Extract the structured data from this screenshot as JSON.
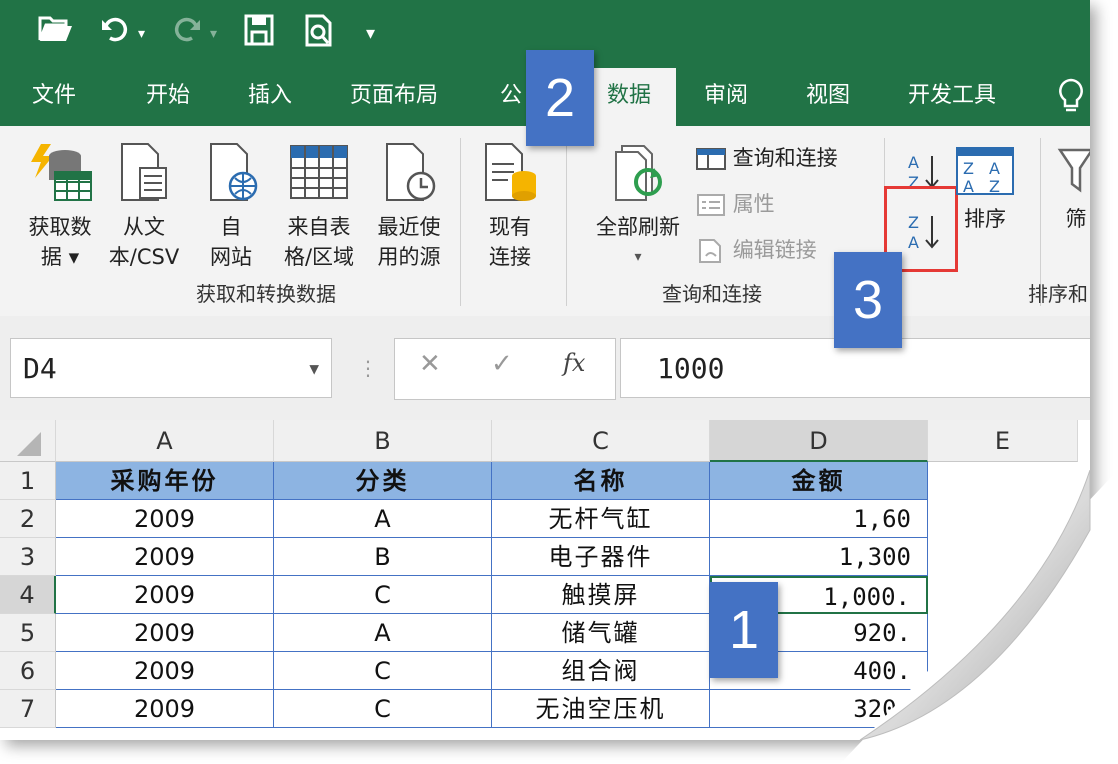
{
  "quick_access": {
    "open_icon": "folder-open-icon",
    "undo_icon": "undo-icon",
    "redo_icon": "redo-icon",
    "save_icon": "save-icon",
    "print_preview_icon": "print-preview-icon",
    "customize_icon": "customize-qat-icon"
  },
  "tabs": [
    {
      "label": "文件"
    },
    {
      "label": "开始"
    },
    {
      "label": "插入"
    },
    {
      "label": "页面布局"
    },
    {
      "label": "公"
    },
    {
      "label": "数据"
    },
    {
      "label": "审阅"
    },
    {
      "label": "视图"
    },
    {
      "label": "开发工具"
    }
  ],
  "ribbon": {
    "get_data": "获取数\n据 ▾",
    "from_text": "从文\n本/CSV",
    "from_web": "自\n网站",
    "from_table": "来自表\n格/区域",
    "recent_sources": "最近使\n用的源",
    "existing_connections": "现有\n连接",
    "group_get_transform": "获取和转换数据",
    "refresh_all": "全部刷新",
    "refresh_all_arrow": "▾",
    "queries_connections": "查询和连接",
    "properties": "属性",
    "edit_links": "编辑链接",
    "group_queries": "查询和连接",
    "sort": "排序",
    "filter": "筛",
    "group_sort": "排序和"
  },
  "formula_bar": {
    "name_box": "D4",
    "cancel": "✕",
    "enter": "✓",
    "fx": "fx",
    "value": "1000"
  },
  "sheet": {
    "columns": [
      "A",
      "B",
      "C",
      "D",
      "E"
    ],
    "rows": [
      "1",
      "2",
      "3",
      "4",
      "5",
      "6",
      "7"
    ],
    "header": [
      "采购年份",
      "分类",
      "名称",
      "金额"
    ],
    "data": [
      [
        "2009",
        "A",
        "无杆气缸",
        "1,60"
      ],
      [
        "2009",
        "B",
        "电子器件",
        "1,300"
      ],
      [
        "2009",
        "C",
        "触摸屏",
        "1,000."
      ],
      [
        "2009",
        "A",
        "储气罐",
        "920."
      ],
      [
        "2009",
        "C",
        "组合阀",
        "400."
      ],
      [
        "2009",
        "C",
        "无油空压机",
        "320."
      ]
    ]
  },
  "annotations": {
    "step1": "1",
    "step2": "2",
    "step3": "3",
    "highlight_color": "#e53935",
    "badge_color": "#4472c4"
  },
  "colors": {
    "excel_green": "#217346",
    "header_fill": "#8db4e2",
    "grid_border": "#4472c4"
  }
}
